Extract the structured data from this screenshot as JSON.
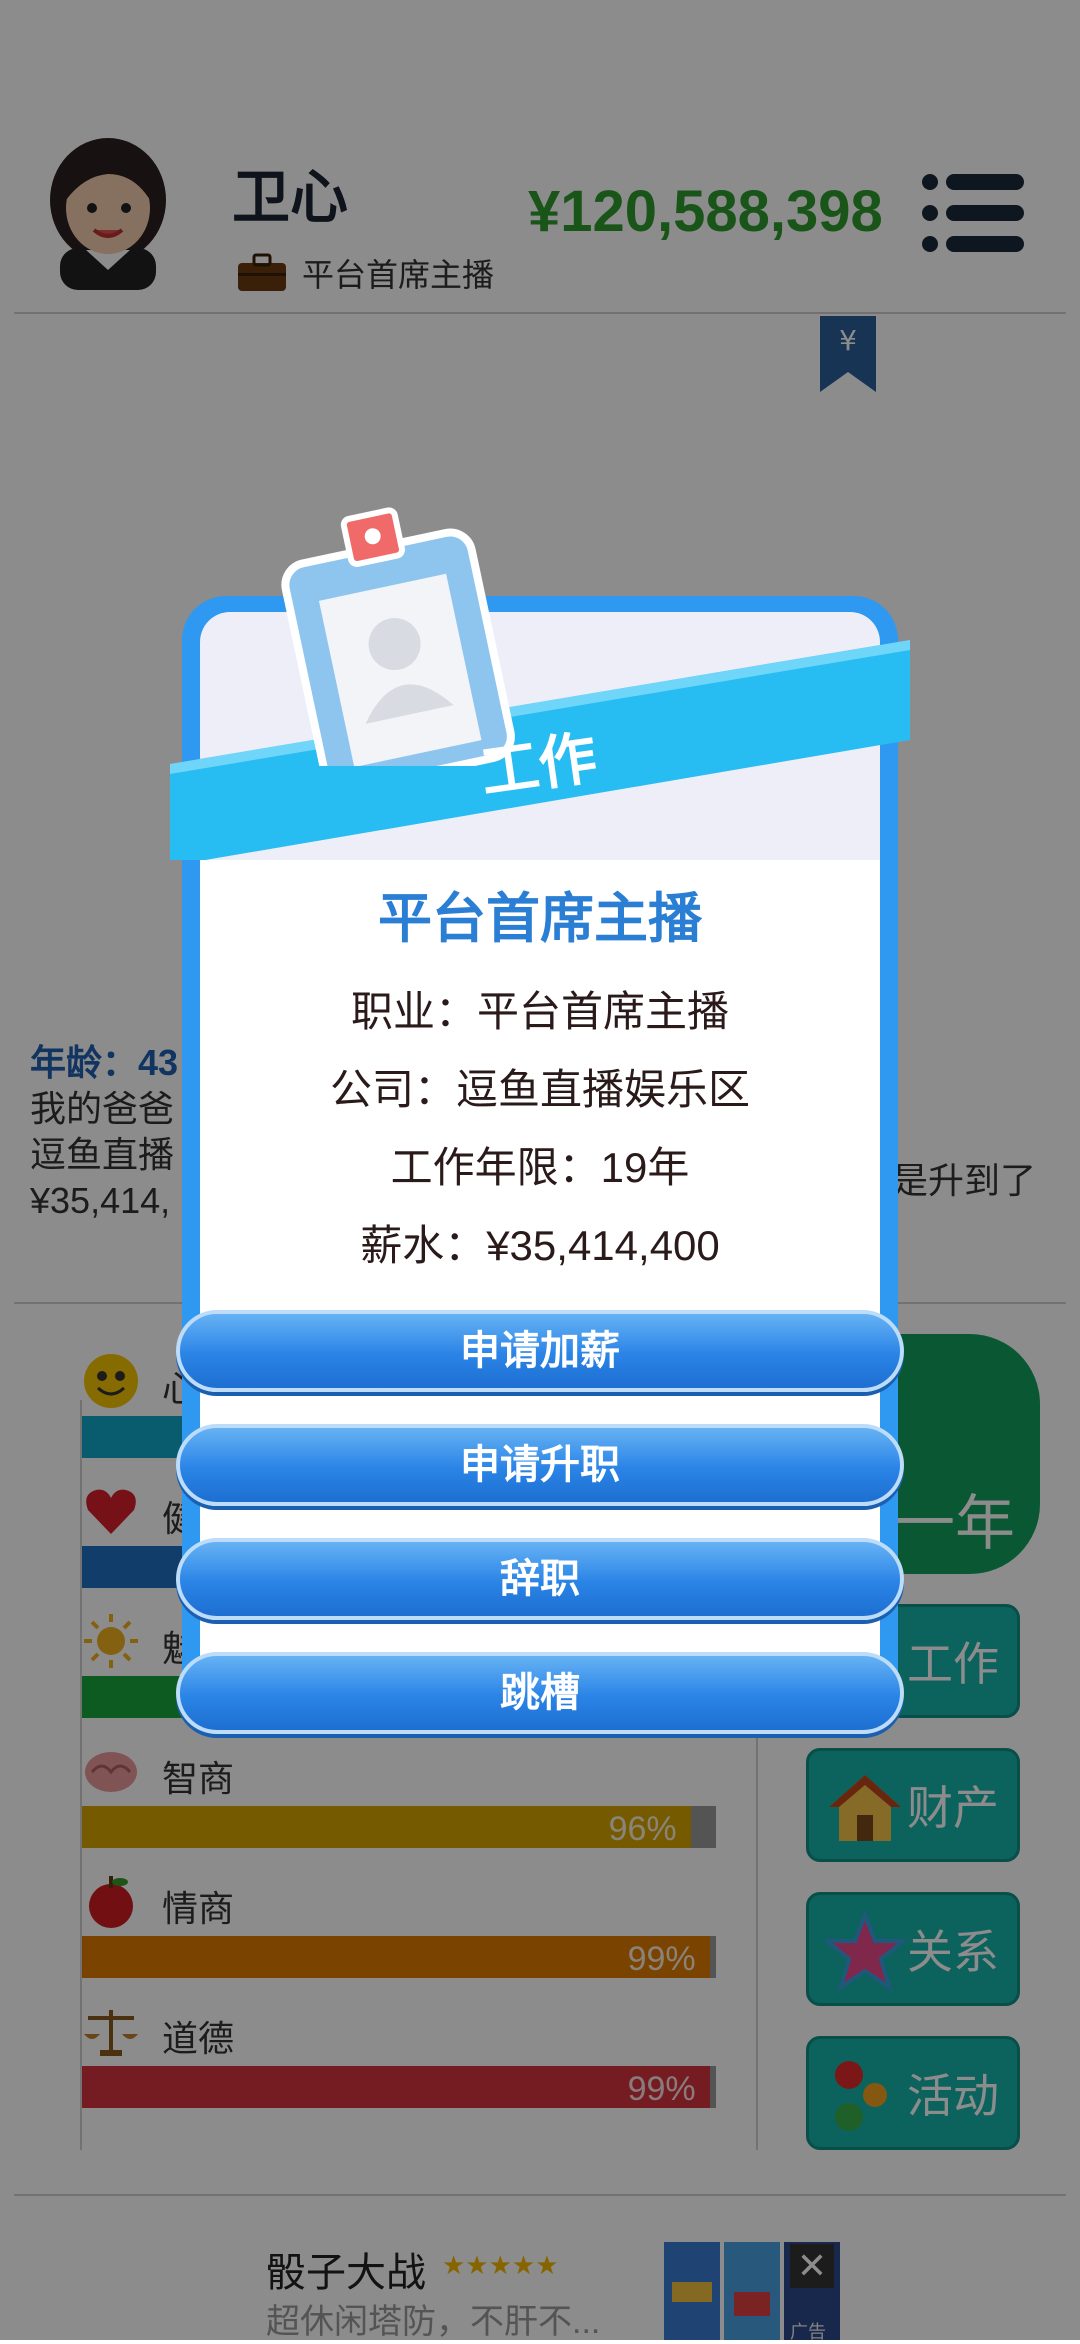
{
  "player": {
    "name": "卫心",
    "job": "平台首席主播",
    "money": "¥120,588,398"
  },
  "bio": {
    "age_label": "年龄：43",
    "line1": "我的爸爸",
    "line2": "逗鱼直播",
    "line2_right": "是升到了",
    "line3": "¥35,414,"
  },
  "stats": [
    {
      "label": "心",
      "percent_text": "",
      "fill": 1.0,
      "color": "#12a6c8",
      "icon": "smile-icon"
    },
    {
      "label": "健",
      "percent_text": "",
      "fill": 1.0,
      "color": "#1f6fc4",
      "icon": "heart-icon"
    },
    {
      "label": "魅",
      "percent_text": "",
      "fill": 1.0,
      "color": "#1aa63c",
      "icon": "sun-icon"
    },
    {
      "label": "智商",
      "percent_text": "96%",
      "fill": 0.96,
      "color": "#d8a400",
      "icon": "brain-icon"
    },
    {
      "label": "情商",
      "percent_text": "99%",
      "fill": 0.99,
      "color": "#e07a00",
      "icon": "apple-icon"
    },
    {
      "label": "道德",
      "percent_text": "99%",
      "fill": 0.99,
      "color": "#d6323e",
      "icon": "scale-icon"
    }
  ],
  "side": {
    "year_label": "一年",
    "work": "工作",
    "assets": "财产",
    "relations": "关系",
    "activities": "活动"
  },
  "dialog": {
    "title": "工作",
    "heading": "平台首席主播",
    "occupation": "职业：平台首席主播",
    "company": "公司：逗鱼直播娱乐区",
    "years": "工作年限：19年",
    "salary": "薪水：¥35,414,400",
    "buttons": {
      "raise": "申请加薪",
      "promote": "申请升职",
      "resign": "辞职",
      "switch": "跳槽"
    }
  },
  "ad": {
    "title": "骰子大战",
    "stars": "★★★★★",
    "subtitle": "超休闲塔防，不肝不...",
    "label": "广告",
    "close": "✕"
  }
}
